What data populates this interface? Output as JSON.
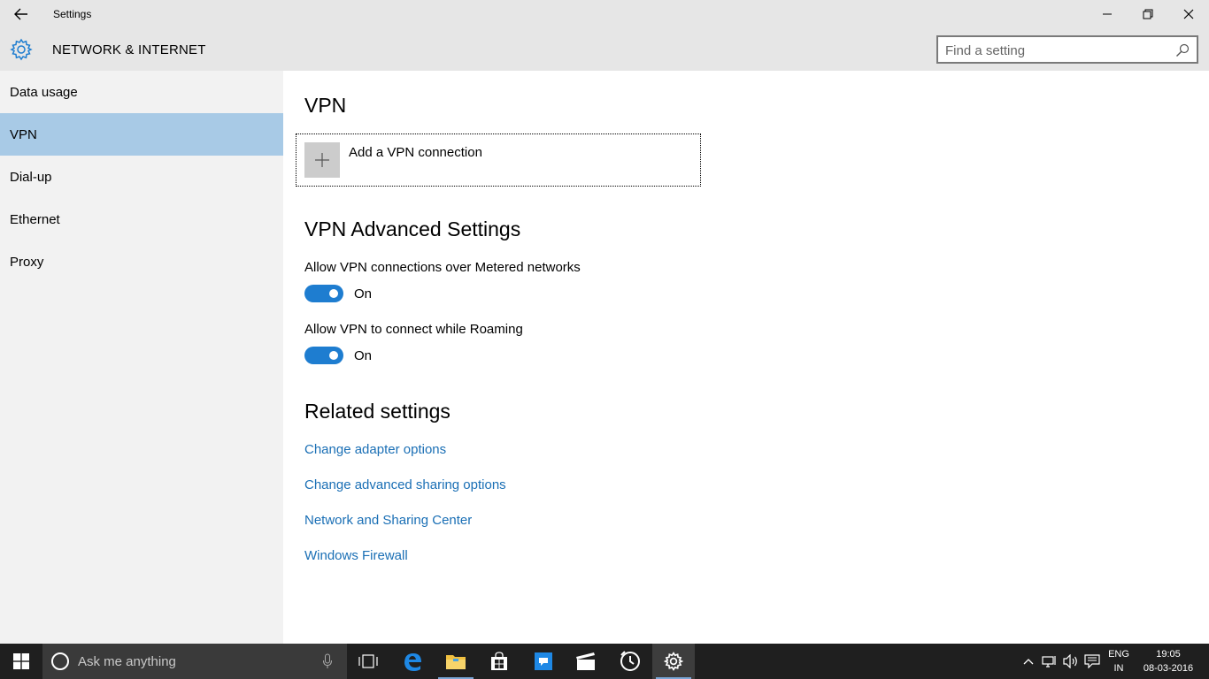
{
  "window": {
    "title": "Settings"
  },
  "header": {
    "title": "NETWORK & INTERNET",
    "search_placeholder": "Find a setting"
  },
  "sidebar": {
    "items": [
      {
        "label": "Data usage",
        "selected": false
      },
      {
        "label": "VPN",
        "selected": true
      },
      {
        "label": "Dial-up",
        "selected": false
      },
      {
        "label": "Ethernet",
        "selected": false
      },
      {
        "label": "Proxy",
        "selected": false
      }
    ]
  },
  "main": {
    "vpn_heading": "VPN",
    "add_vpn_label": "Add a VPN connection",
    "advanced_heading": "VPN Advanced Settings",
    "settings": [
      {
        "label": "Allow VPN connections over Metered networks",
        "state": "On"
      },
      {
        "label": "Allow VPN to connect while Roaming",
        "state": "On"
      }
    ],
    "related_heading": "Related settings",
    "links": [
      "Change adapter options",
      "Change advanced sharing options",
      "Network and Sharing Center",
      "Windows Firewall"
    ]
  },
  "taskbar": {
    "search_text": "Ask me anything",
    "language_top": "ENG",
    "language_bottom": "IN",
    "time": "19:05",
    "date": "08-03-2016"
  },
  "colors": {
    "accent": "#1e7dd0",
    "link": "#1a6fb5",
    "sidebar_selected": "#a8cae6",
    "taskbar": "#1f1f1f"
  }
}
